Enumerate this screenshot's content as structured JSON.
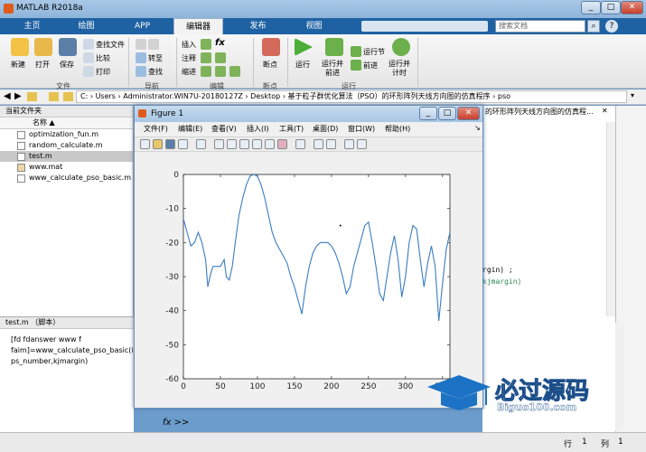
{
  "window": {
    "title": "MATLAB R2018a"
  },
  "tabs": [
    "主页",
    "绘图",
    "APP",
    "编辑器",
    "发布",
    "视图"
  ],
  "search_placeholder": "搜索文档",
  "ribbon": {
    "file_group": "文件",
    "nav_group": "导航",
    "edit_group": "编辑",
    "breakpoint_group": "断点",
    "run_group": "运行",
    "new": "新建",
    "open": "打开",
    "save": "保存",
    "find_files": "查找文件",
    "compare": "比较",
    "print": "打印",
    "goto": "转至",
    "find": "查找",
    "insert": "插入",
    "comment": "注释",
    "indent": "缩进",
    "breakpoints": "断点",
    "run": "运行",
    "run_advance": "运行并\n前进",
    "run_section": "运行节",
    "advance": "前进",
    "run_time": "运行并\n计时"
  },
  "address": {
    "path": "C: › Users › Administrator.WIN7U-20180127Z › Desktop › 基于粒子群优化算法（PSO）的环形阵列天线方向图的仿真程序 › pso"
  },
  "left_panel": {
    "header": "当前文件夹",
    "col_name": "名称",
    "files": [
      "optimization_fun.m",
      "random_calculate.m",
      "test.m",
      "www.mat",
      "www_calculate_pso_basic.m"
    ],
    "selected_index": 2,
    "detail_header": "test.m  （脚本）",
    "detail_code": [
      "[fd fdanswer www f",
      "faim]=www_calculate_pso_basic(itm",
      "ps_number,kjmargin)"
    ]
  },
  "editor_right": {
    "tab_title": "的环形阵列天线方向图的仿真程...",
    "code": [
      "rgin) ;",
      "kjmargin)"
    ]
  },
  "cmd": {
    "prompt": "fx >>"
  },
  "status": {
    "row_label": "行",
    "row": "1",
    "col_label": "列",
    "col": "1"
  },
  "figure": {
    "title": "Figure 1",
    "menu": [
      "文件(F)",
      "编辑(E)",
      "查看(V)",
      "插入(I)",
      "工具(T)",
      "桌面(D)",
      "窗口(W)",
      "帮助(H)"
    ]
  },
  "chart_data": {
    "type": "line",
    "title": "",
    "xlabel": "",
    "ylabel": "",
    "xlim": [
      0,
      360
    ],
    "ylim": [
      -60,
      0
    ],
    "xticks": [
      0,
      50,
      100,
      150,
      200,
      250,
      300,
      350
    ],
    "yticks": [
      0,
      -10,
      -20,
      -30,
      -40,
      -50,
      -60
    ],
    "color": "#3a7dc0",
    "series": [
      {
        "x": [
          0,
          5,
          10,
          15,
          20,
          25,
          30,
          33,
          37,
          40,
          45,
          50,
          55,
          58,
          62,
          66,
          70,
          75,
          80,
          85,
          90,
          95,
          100,
          105,
          110,
          115,
          120,
          125,
          130,
          135,
          140,
          145,
          150,
          155,
          160,
          165,
          170,
          175,
          180,
          185,
          190,
          195,
          200,
          205,
          210,
          215,
          220,
          225,
          230,
          235,
          240,
          245,
          250,
          255,
          260,
          265,
          270,
          275,
          280,
          285,
          290,
          295,
          300,
          305,
          310,
          315,
          320,
          325,
          330,
          335,
          340,
          345,
          350,
          355,
          360
        ],
        "y": [
          -13,
          -17,
          -21,
          -20,
          -17,
          -20,
          -25,
          -33,
          -29,
          -27,
          -27,
          -27,
          -25,
          -30,
          -31,
          -27,
          -20,
          -12,
          -7,
          -3,
          -0.5,
          0,
          -0.5,
          -3,
          -7,
          -12,
          -17,
          -20,
          -22,
          -24,
          -26,
          -30,
          -33,
          -37,
          -41,
          -33,
          -27,
          -23,
          -21,
          -20,
          -20,
          -20,
          -21,
          -23,
          -26,
          -30,
          -35,
          -33,
          -27,
          -23,
          -19,
          -15,
          -14,
          -20,
          -27,
          -35,
          -37,
          -30,
          -23,
          -18,
          -25,
          -36,
          -30,
          -20,
          -15,
          -16,
          -25,
          -33,
          -26,
          -21,
          -27,
          -43,
          -32,
          -22,
          -17
        ]
      }
    ],
    "extra_marker": {
      "x": 212,
      "y": -15
    }
  },
  "watermark": {
    "text": "必过源码",
    "subtext": "Biguo100.com"
  }
}
